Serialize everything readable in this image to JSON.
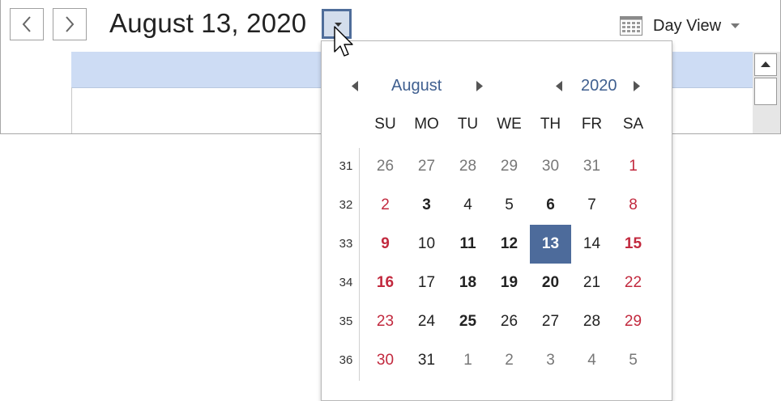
{
  "header": {
    "current_date": "August 13, 2020",
    "view": "Day View"
  },
  "calendar": {
    "month": "August",
    "year": "2020",
    "weekdays": [
      "SU",
      "MO",
      "TU",
      "WE",
      "TH",
      "FR",
      "SA"
    ],
    "weeks": [
      {
        "number": "31",
        "days": [
          {
            "d": "26",
            "other": true
          },
          {
            "d": "27",
            "other": true
          },
          {
            "d": "28",
            "other": true
          },
          {
            "d": "29",
            "other": true
          },
          {
            "d": "30",
            "other": true
          },
          {
            "d": "31",
            "other": true
          },
          {
            "d": "1",
            "weekend": true
          }
        ]
      },
      {
        "number": "32",
        "days": [
          {
            "d": "2",
            "weekend": true
          },
          {
            "d": "3",
            "bold": true
          },
          {
            "d": "4"
          },
          {
            "d": "5"
          },
          {
            "d": "6",
            "bold": true
          },
          {
            "d": "7"
          },
          {
            "d": "8",
            "weekend": true
          }
        ]
      },
      {
        "number": "33",
        "days": [
          {
            "d": "9",
            "weekend": true,
            "bold": true
          },
          {
            "d": "10"
          },
          {
            "d": "11",
            "bold": true
          },
          {
            "d": "12",
            "bold": true
          },
          {
            "d": "13",
            "selected": true
          },
          {
            "d": "14"
          },
          {
            "d": "15",
            "weekend": true,
            "bold": true
          }
        ]
      },
      {
        "number": "34",
        "days": [
          {
            "d": "16",
            "weekend": true,
            "bold": true
          },
          {
            "d": "17"
          },
          {
            "d": "18",
            "bold": true
          },
          {
            "d": "19",
            "bold": true
          },
          {
            "d": "20",
            "bold": true
          },
          {
            "d": "21"
          },
          {
            "d": "22",
            "weekend": true
          }
        ]
      },
      {
        "number": "35",
        "days": [
          {
            "d": "23",
            "weekend": true
          },
          {
            "d": "24"
          },
          {
            "d": "25",
            "bold": true
          },
          {
            "d": "26"
          },
          {
            "d": "27"
          },
          {
            "d": "28"
          },
          {
            "d": "29",
            "weekend": true
          }
        ]
      },
      {
        "number": "36",
        "days": [
          {
            "d": "30",
            "weekend": true
          },
          {
            "d": "31"
          },
          {
            "d": "1",
            "other": true
          },
          {
            "d": "2",
            "other": true
          },
          {
            "d": "3",
            "other": true
          },
          {
            "d": "4",
            "other": true
          },
          {
            "d": "5",
            "other": true
          }
        ]
      }
    ]
  },
  "colors": {
    "accent": "#4d6b9b",
    "header_link": "#3f5f8f",
    "weekend": "#c2293e",
    "column_header": "#cddcf4"
  },
  "icons": [
    "chevron-left-icon",
    "chevron-right-icon",
    "dropdown-arrow-icon",
    "calendar-grid-icon",
    "mouse-cursor-icon"
  ]
}
